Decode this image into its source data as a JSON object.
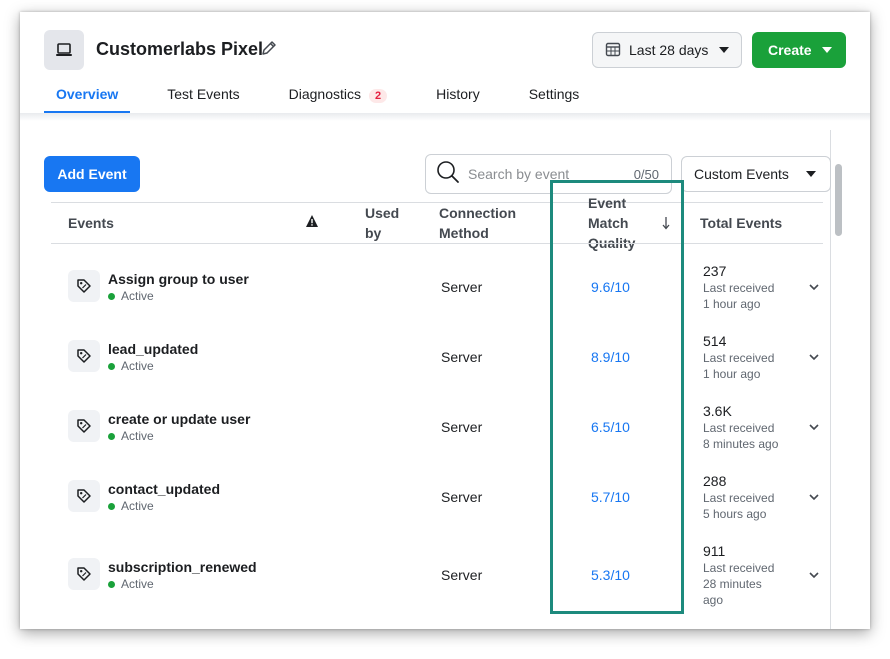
{
  "header": {
    "title": "Customerlabs Pixel",
    "date_range": "Last 28 days",
    "create_label": "Create"
  },
  "tabs": [
    {
      "label": "Overview",
      "active": true
    },
    {
      "label": "Test Events"
    },
    {
      "label": "Diagnostics",
      "badge": "2"
    },
    {
      "label": "History"
    },
    {
      "label": "Settings"
    }
  ],
  "toolbar": {
    "add_event_label": "Add Event",
    "search_placeholder": "Search by event",
    "search_count": "0/50",
    "filter_label": "Custom Events"
  },
  "table": {
    "headers": {
      "events": "Events",
      "used_by": "Used by",
      "connection_method": "Connection Method",
      "emq": "Event Match Quality",
      "total_events": "Total Events"
    },
    "rows": [
      {
        "name": "Assign group to user",
        "status": "Active",
        "connection": "Server",
        "emq": "9.6/10",
        "total": "237",
        "last_received_label": "Last received",
        "last_received": "1 hour ago"
      },
      {
        "name": "lead_updated",
        "status": "Active",
        "connection": "Server",
        "emq": "8.9/10",
        "total": "514",
        "last_received_label": "Last received",
        "last_received": "1 hour ago"
      },
      {
        "name": "create or update user",
        "status": "Active",
        "connection": "Server",
        "emq": "6.5/10",
        "total": "3.6K",
        "last_received_label": "Last received",
        "last_received": "8 minutes ago"
      },
      {
        "name": "contact_updated",
        "status": "Active",
        "connection": "Server",
        "emq": "5.7/10",
        "total": "288",
        "last_received_label": "Last received",
        "last_received": "5 hours ago"
      },
      {
        "name": "subscription_renewed",
        "status": "Active",
        "connection": "Server",
        "emq": "5.3/10",
        "total": "911",
        "last_received_label": "Last received",
        "last_received": "28 minutes ago"
      }
    ]
  },
  "colors": {
    "primary": "#1877f2",
    "create_green": "#1aa13a",
    "highlight": "#1d8a7d",
    "active_dot": "#1aa13a"
  }
}
